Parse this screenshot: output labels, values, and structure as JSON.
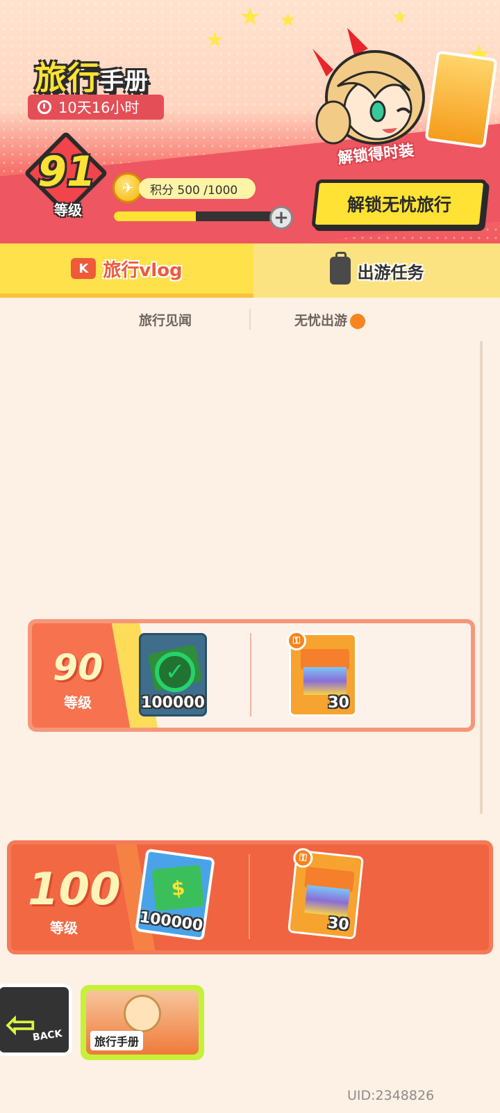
{
  "header": {
    "title_main": "旅行",
    "title_small": "手册",
    "timer": "10天16小时",
    "costume_label": "解锁得时装",
    "level": {
      "value": "91",
      "label": "等级"
    },
    "points": {
      "text": "积分 500 /1000",
      "progress_fraction": 0.5
    },
    "unlock_button": "解锁无忧旅行"
  },
  "tabs": {
    "active": "旅行vlog",
    "inactive": "出游任务",
    "vlog_icon_text": "K"
  },
  "subtabs": {
    "left": "旅行见闻",
    "right": "无忧出游"
  },
  "rows": [
    {
      "level": "90",
      "level_label": "等级",
      "reward_free": {
        "icon": "cash-icon",
        "count": "100000",
        "claimed": true
      },
      "reward_locked": {
        "icon": "gift-box-icon",
        "count": "30",
        "locked": true
      }
    },
    {
      "level": "100",
      "level_label": "等级",
      "reward_free": {
        "icon": "cash-icon",
        "count": "100000",
        "claimed": false
      },
      "reward_locked": {
        "icon": "gift-box-icon",
        "count": "30",
        "locked": true
      }
    }
  ],
  "bottom": {
    "back_label": "BACK",
    "handbook_label": "旅行手册"
  },
  "uid": "UID:2348826",
  "colors": {
    "accent_yellow": "#ffe233",
    "accent_red": "#f05a60",
    "accent_orange": "#f06441",
    "background": "#fdf0e4"
  }
}
